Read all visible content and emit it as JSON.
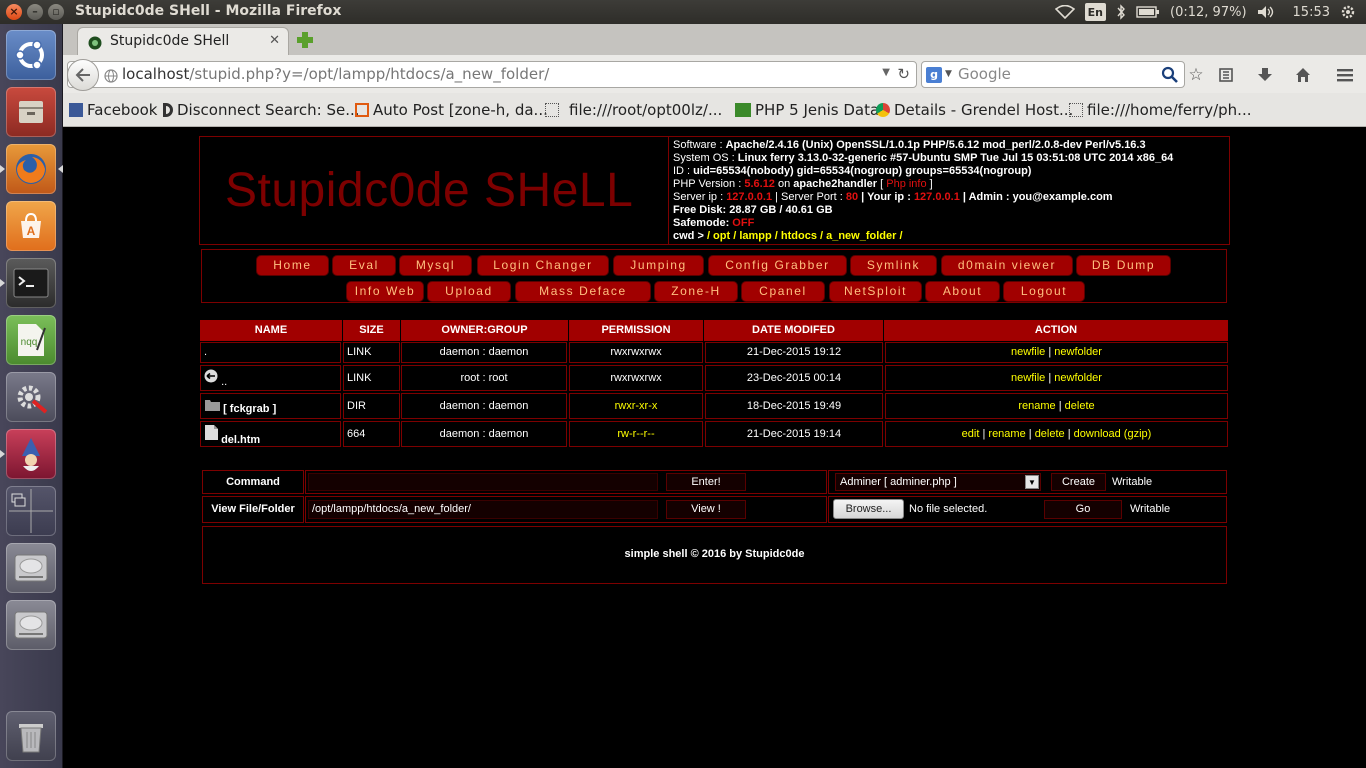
{
  "top_panel": {
    "window_title": "Stupidc0de SHell - Mozilla Firefox",
    "keyboard": "En",
    "battery": "(0:12, 97%)",
    "clock": "15:53"
  },
  "launcher": {
    "items": [
      "ubuntu-dash",
      "files",
      "firefox",
      "software-center",
      "terminal",
      "text-editor",
      "system-settings",
      "wizard-app",
      "workspace-switcher",
      "drive-1",
      "drive-2",
      "trash"
    ]
  },
  "browser": {
    "tab_title": "Stupidc0de SHell",
    "tab_close": "✕",
    "url_host": "localhost",
    "url_path": "/stupid.php?y=/opt/lampp/htdocs/a_new_folder/",
    "search_engine": "g",
    "search_placeholder": "Google",
    "bookmarks": [
      "Facebook",
      "Disconnect Search: Se...",
      "Auto Post [zone-h, da...",
      "file:///root/opt00lz/...",
      "PHP 5 Jenis Data",
      "Details - Grendel Host...",
      "file:///home/ferry/ph..."
    ]
  },
  "shell": {
    "logo": "Stupidc0de SHeLL",
    "info": {
      "software_label": "Software : ",
      "software": "Apache/2.4.16 (Unix) OpenSSL/1.0.1p PHP/5.6.12 mod_perl/2.0.8-dev Perl/v5.16.3",
      "os_label": "System OS : ",
      "os": "Linux ferry 3.13.0-32-generic #57-Ubuntu SMP Tue Jul 15 03:51:08 UTC 2014 x86_64",
      "id_label": "ID : ",
      "id": "uid=65534(nobody) gid=65534(nogroup) groups=65534(nogroup)",
      "php_label": "PHP Version : ",
      "php_version": "5.6.12",
      "php_on": " on ",
      "php_sapi": "apache2handler",
      "php_info_open": " [ ",
      "php_info": "Php info",
      "php_info_close": " ]",
      "server_ip_label": "Server ip : ",
      "server_ip": "127.0.0.1",
      "server_port_label": " | Server Port : ",
      "server_port": "80",
      "your_ip_label": " | Your ip : ",
      "your_ip": "127.0.0.1",
      "admin_label": " | Admin : ",
      "admin": "you@example.com",
      "disk_label": "Free Disk: ",
      "disk": "28.87 GB / 40.61 GB",
      "safemode_label": "Safemode: ",
      "safemode": "OFF",
      "cwd_label": "cwd > ",
      "cwd": "/ opt / lampp / htdocs / a_new_folder /"
    },
    "menu_row1": [
      "Home",
      "Eval",
      "Mysql",
      "Login Changer",
      "Jumping",
      "Config Grabber",
      "Symlink",
      "d0main viewer",
      "DB Dump"
    ],
    "menu_row2": [
      "Info Web",
      "Upload",
      "Mass Deface",
      "Zone-H",
      "Cpanel",
      "NetSploit",
      "About",
      "Logout"
    ],
    "table": {
      "headers": [
        "NAME",
        "SIZE",
        "OWNER:GROUP",
        "PERMISSION",
        "DATE MODIFED",
        "ACTION"
      ],
      "rows": [
        {
          "name": ".",
          "size": "LINK",
          "owner": "daemon : daemon",
          "perm": "rwxrwxrwx",
          "date": "21-Dec-2015 19:12",
          "actions": [
            "newfile",
            "newfolder"
          ]
        },
        {
          "name": "..",
          "size": "LINK",
          "owner": "root : root",
          "perm": "rwxrwxrwx",
          "date": "23-Dec-2015 00:14",
          "actions": [
            "newfile",
            "newfolder"
          ]
        },
        {
          "name": "[ fckgrab ]",
          "size": "DIR",
          "owner": "daemon : daemon",
          "perm": "rwxr-xr-x",
          "date": "18-Dec-2015 19:49",
          "actions": [
            "rename",
            "delete"
          ]
        },
        {
          "name": "del.htm",
          "size": "664",
          "owner": "daemon : daemon",
          "perm": "rw-r--r--",
          "date": "21-Dec-2015 19:14",
          "actions": [
            "edit",
            "rename",
            "delete",
            "download (gzip)"
          ]
        }
      ],
      "separator": " | "
    },
    "command": {
      "label": "Command",
      "value": "",
      "button": "Enter!",
      "select_value": "Adminer [ adminer.php ]",
      "create_button": "Create",
      "create_status": "Writable"
    },
    "view": {
      "label": "View File/Folder",
      "value": "/opt/lampp/htdocs/a_new_folder/",
      "button": "View !",
      "browse_button": "Browse...",
      "file_status": "No file selected.",
      "go_button": "Go",
      "upload_status": "Writable"
    },
    "footer": "simple shell © 2016 by Stupidc0de"
  },
  "colors": {
    "accent_red": "#a10000",
    "border_red": "#7d0000",
    "link_yellow": "#ffff00",
    "menu_text": "#ffc080"
  }
}
